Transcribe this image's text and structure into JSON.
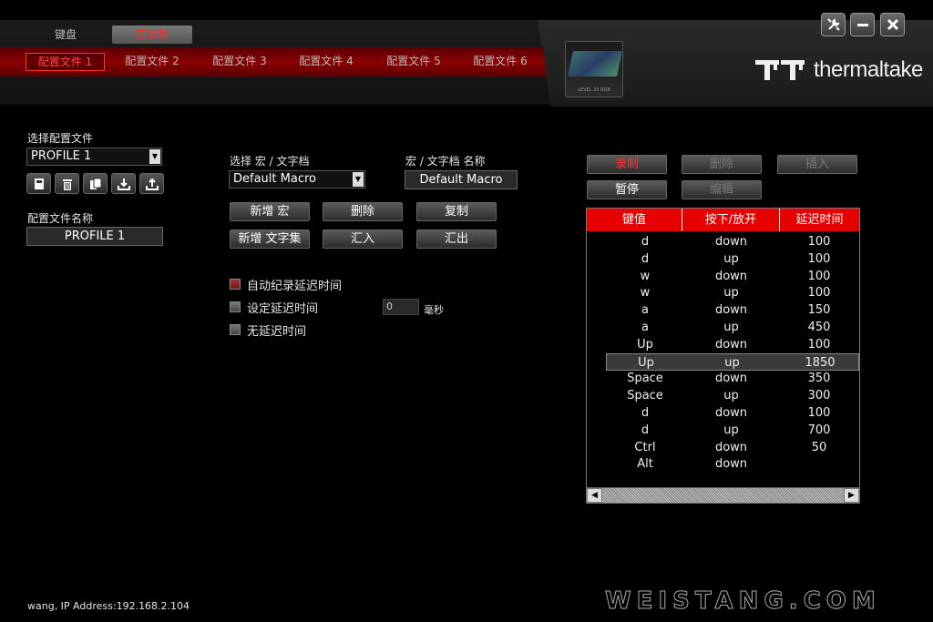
{
  "main_tabs": [
    {
      "label": "键盘",
      "active": false
    },
    {
      "label": "宏录制",
      "active": true
    }
  ],
  "profile_tabs": [
    {
      "label": "配置文件 1",
      "active": true
    },
    {
      "label": "配置文件 2",
      "active": false
    },
    {
      "label": "配置文件 3",
      "active": false
    },
    {
      "label": "配置文件 4",
      "active": false
    },
    {
      "label": "配置文件 5",
      "active": false
    },
    {
      "label": "配置文件 6",
      "active": false
    }
  ],
  "device": {
    "label": "LEVEL 20 RGB"
  },
  "brand": {
    "name": "thermaltake"
  },
  "window_controls": [
    "wrench-icon",
    "minimize-icon",
    "close-icon"
  ],
  "left_panel": {
    "select_profile_label": "选择配置文件",
    "selected_profile": "PROFILE 1",
    "profile_icons": [
      "save-icon",
      "delete-icon",
      "copy-icon",
      "import-icon",
      "export-icon"
    ],
    "profile_name_label": "配置文件名称",
    "profile_name_value": "PROFILE 1"
  },
  "macro_panel": {
    "select_label": "选择 宏 / 文字档",
    "selected_macro": "Default Macro",
    "name_label": "宏 / 文字档 名称",
    "name_value": "Default Macro",
    "buttons": {
      "new_macro": "新增 宏",
      "delete": "删除",
      "copy": "复制",
      "new_text": "新增 文字集",
      "import": "汇入",
      "export": "汇出"
    },
    "options": [
      {
        "label": "自动纪录延迟时间",
        "checked": true
      },
      {
        "label": "设定延迟时间",
        "checked": false
      },
      {
        "label": "无延迟时间",
        "checked": false
      }
    ],
    "delay_value": "0",
    "delay_unit": "毫秒"
  },
  "record_panel": {
    "buttons": {
      "record": "录制",
      "delete": "删除",
      "insert": "插入",
      "pause": "暂停",
      "edit": "编辑"
    },
    "columns": [
      "键值",
      "按下/放开",
      "延迟时间"
    ],
    "rows": [
      {
        "key": "d",
        "action": "down",
        "delay": "100"
      },
      {
        "key": "d",
        "action": "up",
        "delay": "100"
      },
      {
        "key": "w",
        "action": "down",
        "delay": "100"
      },
      {
        "key": "w",
        "action": "up",
        "delay": "100"
      },
      {
        "key": "a",
        "action": "down",
        "delay": "150"
      },
      {
        "key": "a",
        "action": "up",
        "delay": "450"
      },
      {
        "key": "Up",
        "action": "down",
        "delay": "100"
      },
      {
        "key": "Up",
        "action": "up",
        "delay": "1850"
      },
      {
        "key": "Space",
        "action": "down",
        "delay": "350"
      },
      {
        "key": "Space",
        "action": "up",
        "delay": "300"
      },
      {
        "key": "d",
        "action": "down",
        "delay": "100"
      },
      {
        "key": "d",
        "action": "up",
        "delay": "700"
      },
      {
        "key": "Ctrl",
        "action": "down",
        "delay": "50"
      },
      {
        "key": "Alt",
        "action": "down",
        "delay": ""
      }
    ],
    "selected_row": 7
  },
  "status_text": "wang, IP Address:192.168.2.104",
  "watermark": "WEISTANG.COM",
  "colors": {
    "accent_red": "#e60000",
    "bar_red": "#8a0000"
  }
}
